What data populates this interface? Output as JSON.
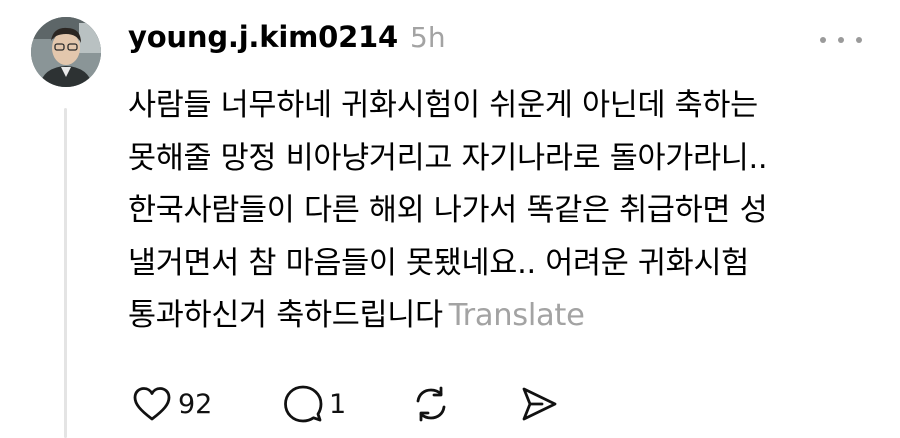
{
  "post": {
    "username": "young.j.kim0214",
    "time_ago": "5h",
    "text_lines": [
      "사람들 너무하네 귀화시험이 쉬운게 아닌데 축하는",
      "못해줄 망정 비아냥거리고 자기나라로 돌아가라니..",
      "한국사람들이 다른 해외 나가서 똑같은 취급하면 성",
      "낼거면서 참 마음들이 못됐네요.. 어려운 귀화시험",
      "통과하신거 축하드립니다"
    ],
    "translate_label": "Translate",
    "likes_count": "92",
    "replies_count": "1"
  },
  "icons": {
    "more": "more-horizontal-icon",
    "like": "heart-icon",
    "reply": "comment-icon",
    "repost": "repost-icon",
    "share": "send-icon"
  },
  "colors": {
    "text": "#000000",
    "muted": "#a3a3a3",
    "thread_line": "#e4e4e4"
  }
}
